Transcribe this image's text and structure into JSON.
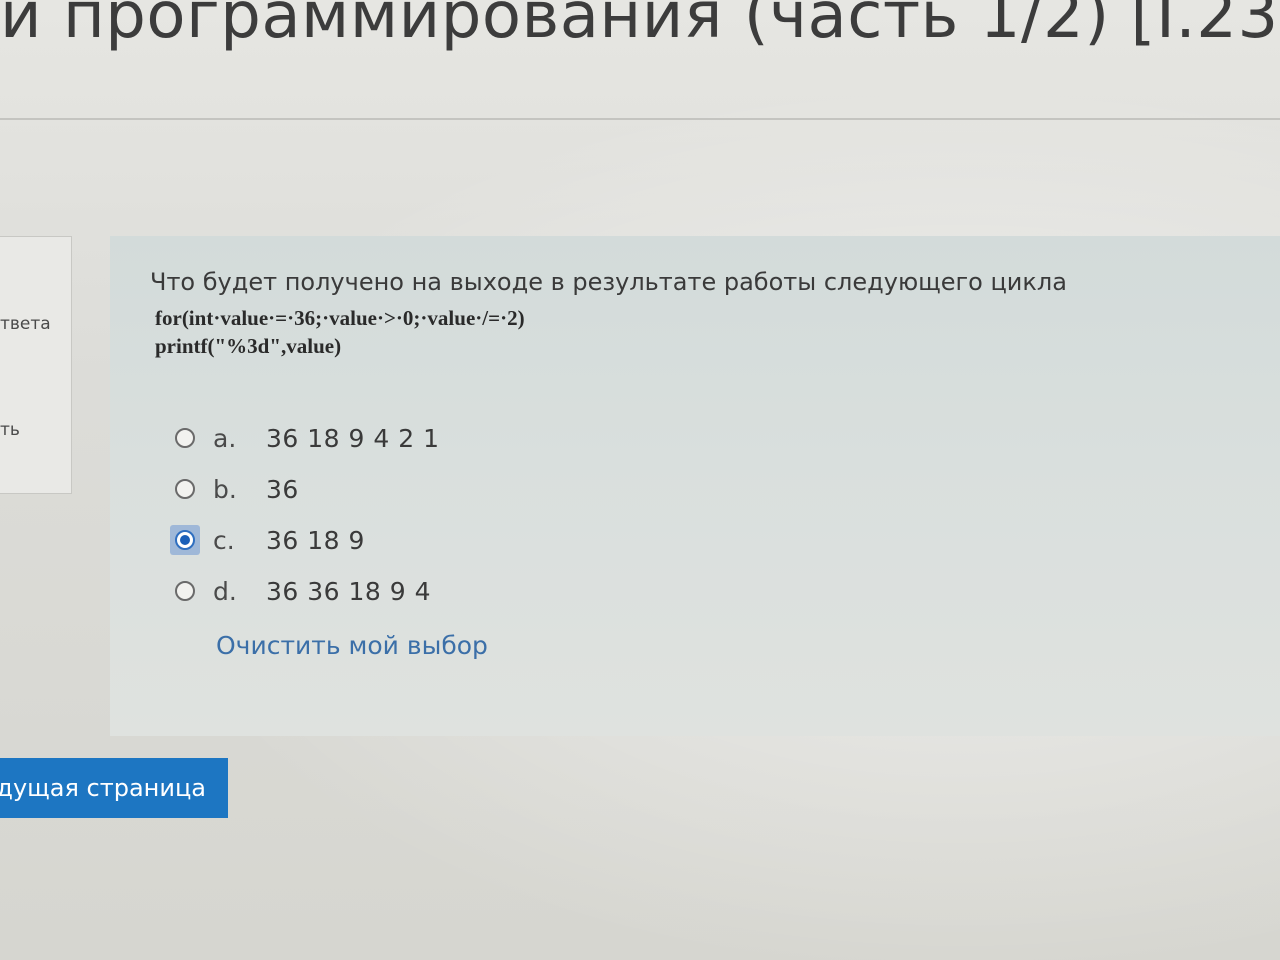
{
  "header": {
    "course_title": "и программирования (часть 1/2) [I.23-24"
  },
  "info_panel": {
    "status_text": "твета",
    "flag_text": "ть"
  },
  "question": {
    "text": "Что будет получено на выходе в результате работы следующего цикла",
    "code_line_1": "for(int·value·=·36;·value·>·0;·value·/=·2)",
    "code_line_2": "printf(\"%3d\",value)",
    "answers": [
      {
        "letter": "a.",
        "text": "36 18 9 4 2 1",
        "checked": false
      },
      {
        "letter": "b.",
        "text": "36",
        "checked": false
      },
      {
        "letter": "c.",
        "text": "36 18 9",
        "checked": true
      },
      {
        "letter": "d.",
        "text": "36 36 18 9 4",
        "checked": false
      }
    ],
    "clear_choice_label": "Очистить мой выбор"
  },
  "navigation": {
    "prev_page_label": "дущая страница"
  },
  "colors": {
    "accent": "#1d76c2",
    "link": "#3b6fa8",
    "selected_highlight": "#9fb8d8"
  }
}
